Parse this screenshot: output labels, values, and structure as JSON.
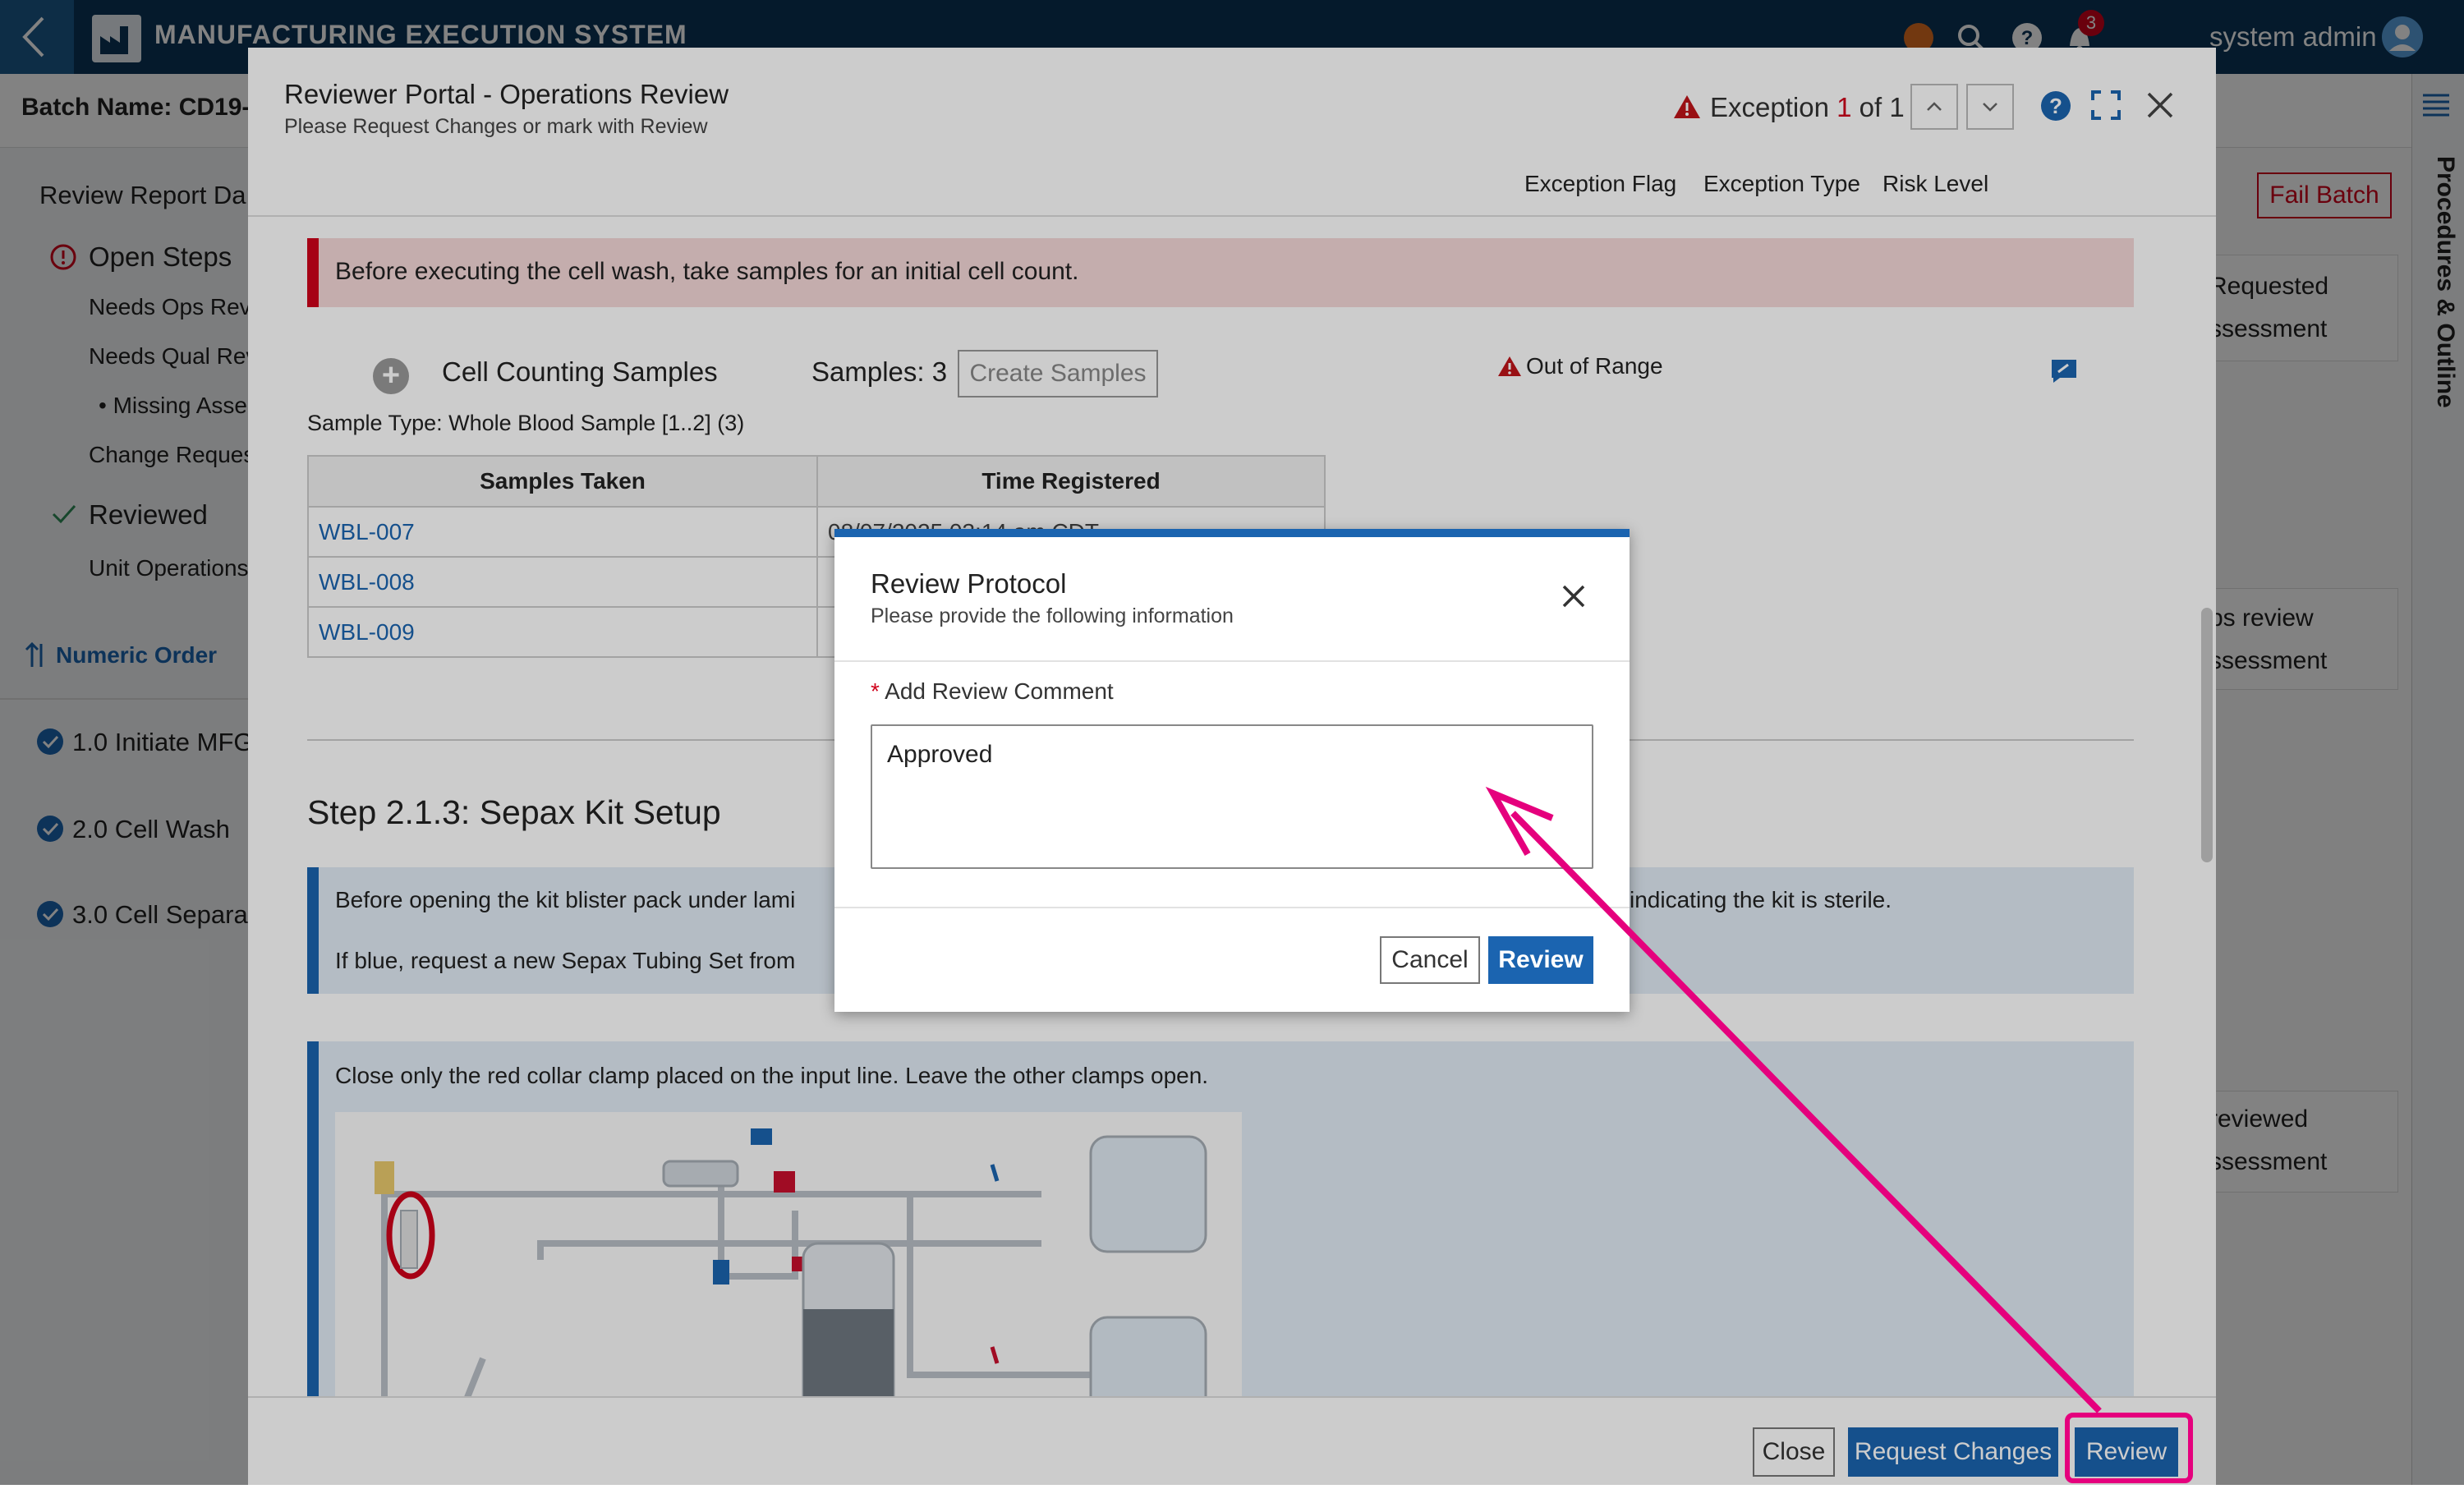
{
  "app": {
    "title": "MANUFACTURING EXECUTION SYSTEM",
    "notification_count": "3",
    "user_name": "system admin"
  },
  "background": {
    "batch_name": "Batch Name: CD19-1",
    "left_panel": {
      "review_report": "Review Report Da",
      "open_steps": "Open Steps",
      "needs_ops": "Needs Ops Revi",
      "needs_qual": "Needs Qual Rev",
      "missing": "Missing Asse",
      "change_requests": "Change Request",
      "reviewed": "Reviewed",
      "unit_operations": "Unit Operations",
      "numeric_order": "Numeric Order",
      "ops": [
        "1.0 Initiate MFG",
        "2.0 Cell Wash",
        "3.0 Cell Separat"
      ]
    },
    "right": {
      "fail_batch": "Fail Batch",
      "cards": [
        {
          "line1": "Requested",
          "line2": "ssessment"
        },
        {
          "line1": "ps review",
          "line2": "ssessment"
        },
        {
          "line1": "reviewed",
          "line2": "ssessment"
        }
      ],
      "rail_label": "Procedures & Outline"
    }
  },
  "reviewer_modal": {
    "title": "Reviewer Portal - Operations Review",
    "subtitle": "Please Request Changes or mark with Review",
    "exception": {
      "prefix": "Exception",
      "current": "1",
      "suffix": "of 1"
    },
    "columns": [
      "Exception Flag",
      "Exception Type",
      "Risk Level"
    ],
    "warning_banner": "Before executing the cell wash, take samples for an initial cell count.",
    "cell_counting": {
      "label": "Cell Counting Samples",
      "samples_count": "Samples: 3",
      "create_button": "Create Samples",
      "out_of_range": "Out of Range",
      "sample_type": "Sample Type: Whole Blood Sample [1..2] (3)",
      "table": {
        "headers": [
          "Samples Taken",
          "Time Registered"
        ],
        "rows": [
          {
            "sample": "WBL-007",
            "time": "08/07/2025 03:14 am CDT"
          },
          {
            "sample": "WBL-008",
            "time": ""
          },
          {
            "sample": "WBL-009",
            "time": ""
          }
        ]
      }
    },
    "step": {
      "title": "Step 2.1.3: Sepax Kit Setup",
      "info1_line1_a": "Before opening the kit blister pack under lami",
      "info1_line1_b": "indicating the kit is sterile.",
      "info1_line2": "If blue, request a new Sepax Tubing Set from",
      "info2_text": "Close only the red collar clamp placed on the input line. Leave the other clamps open."
    },
    "footer": {
      "close": "Close",
      "request_changes": "Request Changes",
      "review": "Review"
    }
  },
  "protocol_dialog": {
    "title": "Review Protocol",
    "subtitle": "Please provide the following information",
    "required_mark": "*",
    "field_label": "Add Review Comment",
    "comment_value": "Approved",
    "cancel": "Cancel",
    "review": "Review"
  },
  "colors": {
    "accent": "#1b64b0",
    "danger": "#d0021b",
    "highlight": "#e5007d",
    "topbar": "#0b3556"
  }
}
